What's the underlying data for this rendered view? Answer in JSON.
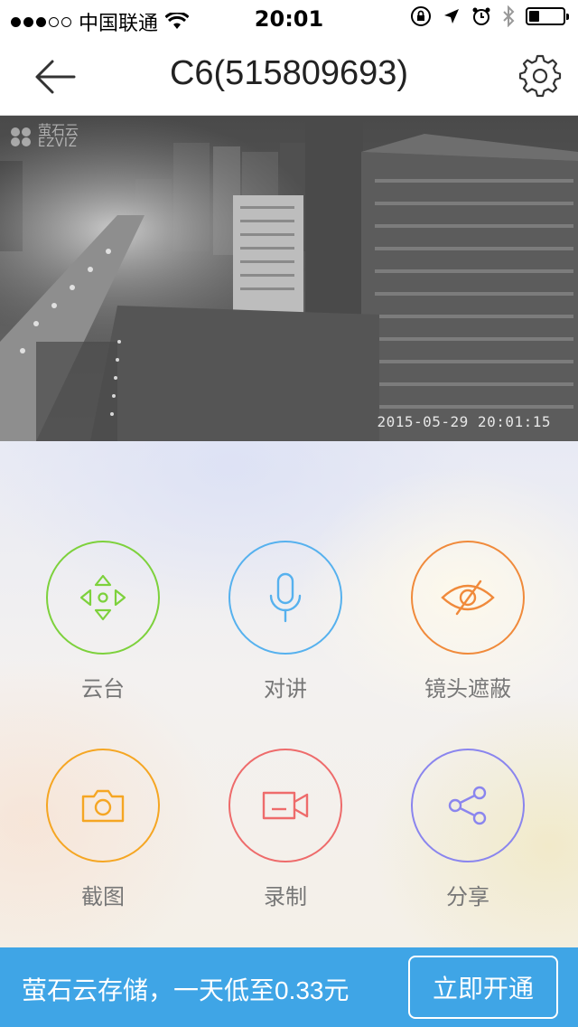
{
  "status_bar": {
    "carrier": "中国联通",
    "time": "20:01",
    "signal_bars_filled": 3,
    "signal_bars_total": 5,
    "battery_level": 0.3
  },
  "nav": {
    "title": "C6(515809693)",
    "back_icon": "back-arrow-icon",
    "settings_icon": "gear-icon"
  },
  "video": {
    "logo_cn": "萤石云",
    "logo_en": "EZVIZ",
    "timestamp": "2015-05-29 20:01:15"
  },
  "controls": [
    {
      "label": "云台",
      "icon": "ptz-direction-icon",
      "color": "#7dd13c"
    },
    {
      "label": "对讲",
      "icon": "microphone-icon",
      "color": "#56b1ee"
    },
    {
      "label": "镜头遮蔽",
      "icon": "eye-slash-icon",
      "color": "#f08a3b"
    },
    {
      "label": "截图",
      "icon": "camera-icon",
      "color": "#f5a623"
    },
    {
      "label": "录制",
      "icon": "video-record-icon",
      "color": "#ee6b6b"
    },
    {
      "label": "分享",
      "icon": "share-icon",
      "color": "#8a85ee"
    }
  ],
  "promo": {
    "text": "萤石云存储，一天低至0.33元",
    "button_label": "立即开通",
    "background": "#3fa5e6"
  }
}
